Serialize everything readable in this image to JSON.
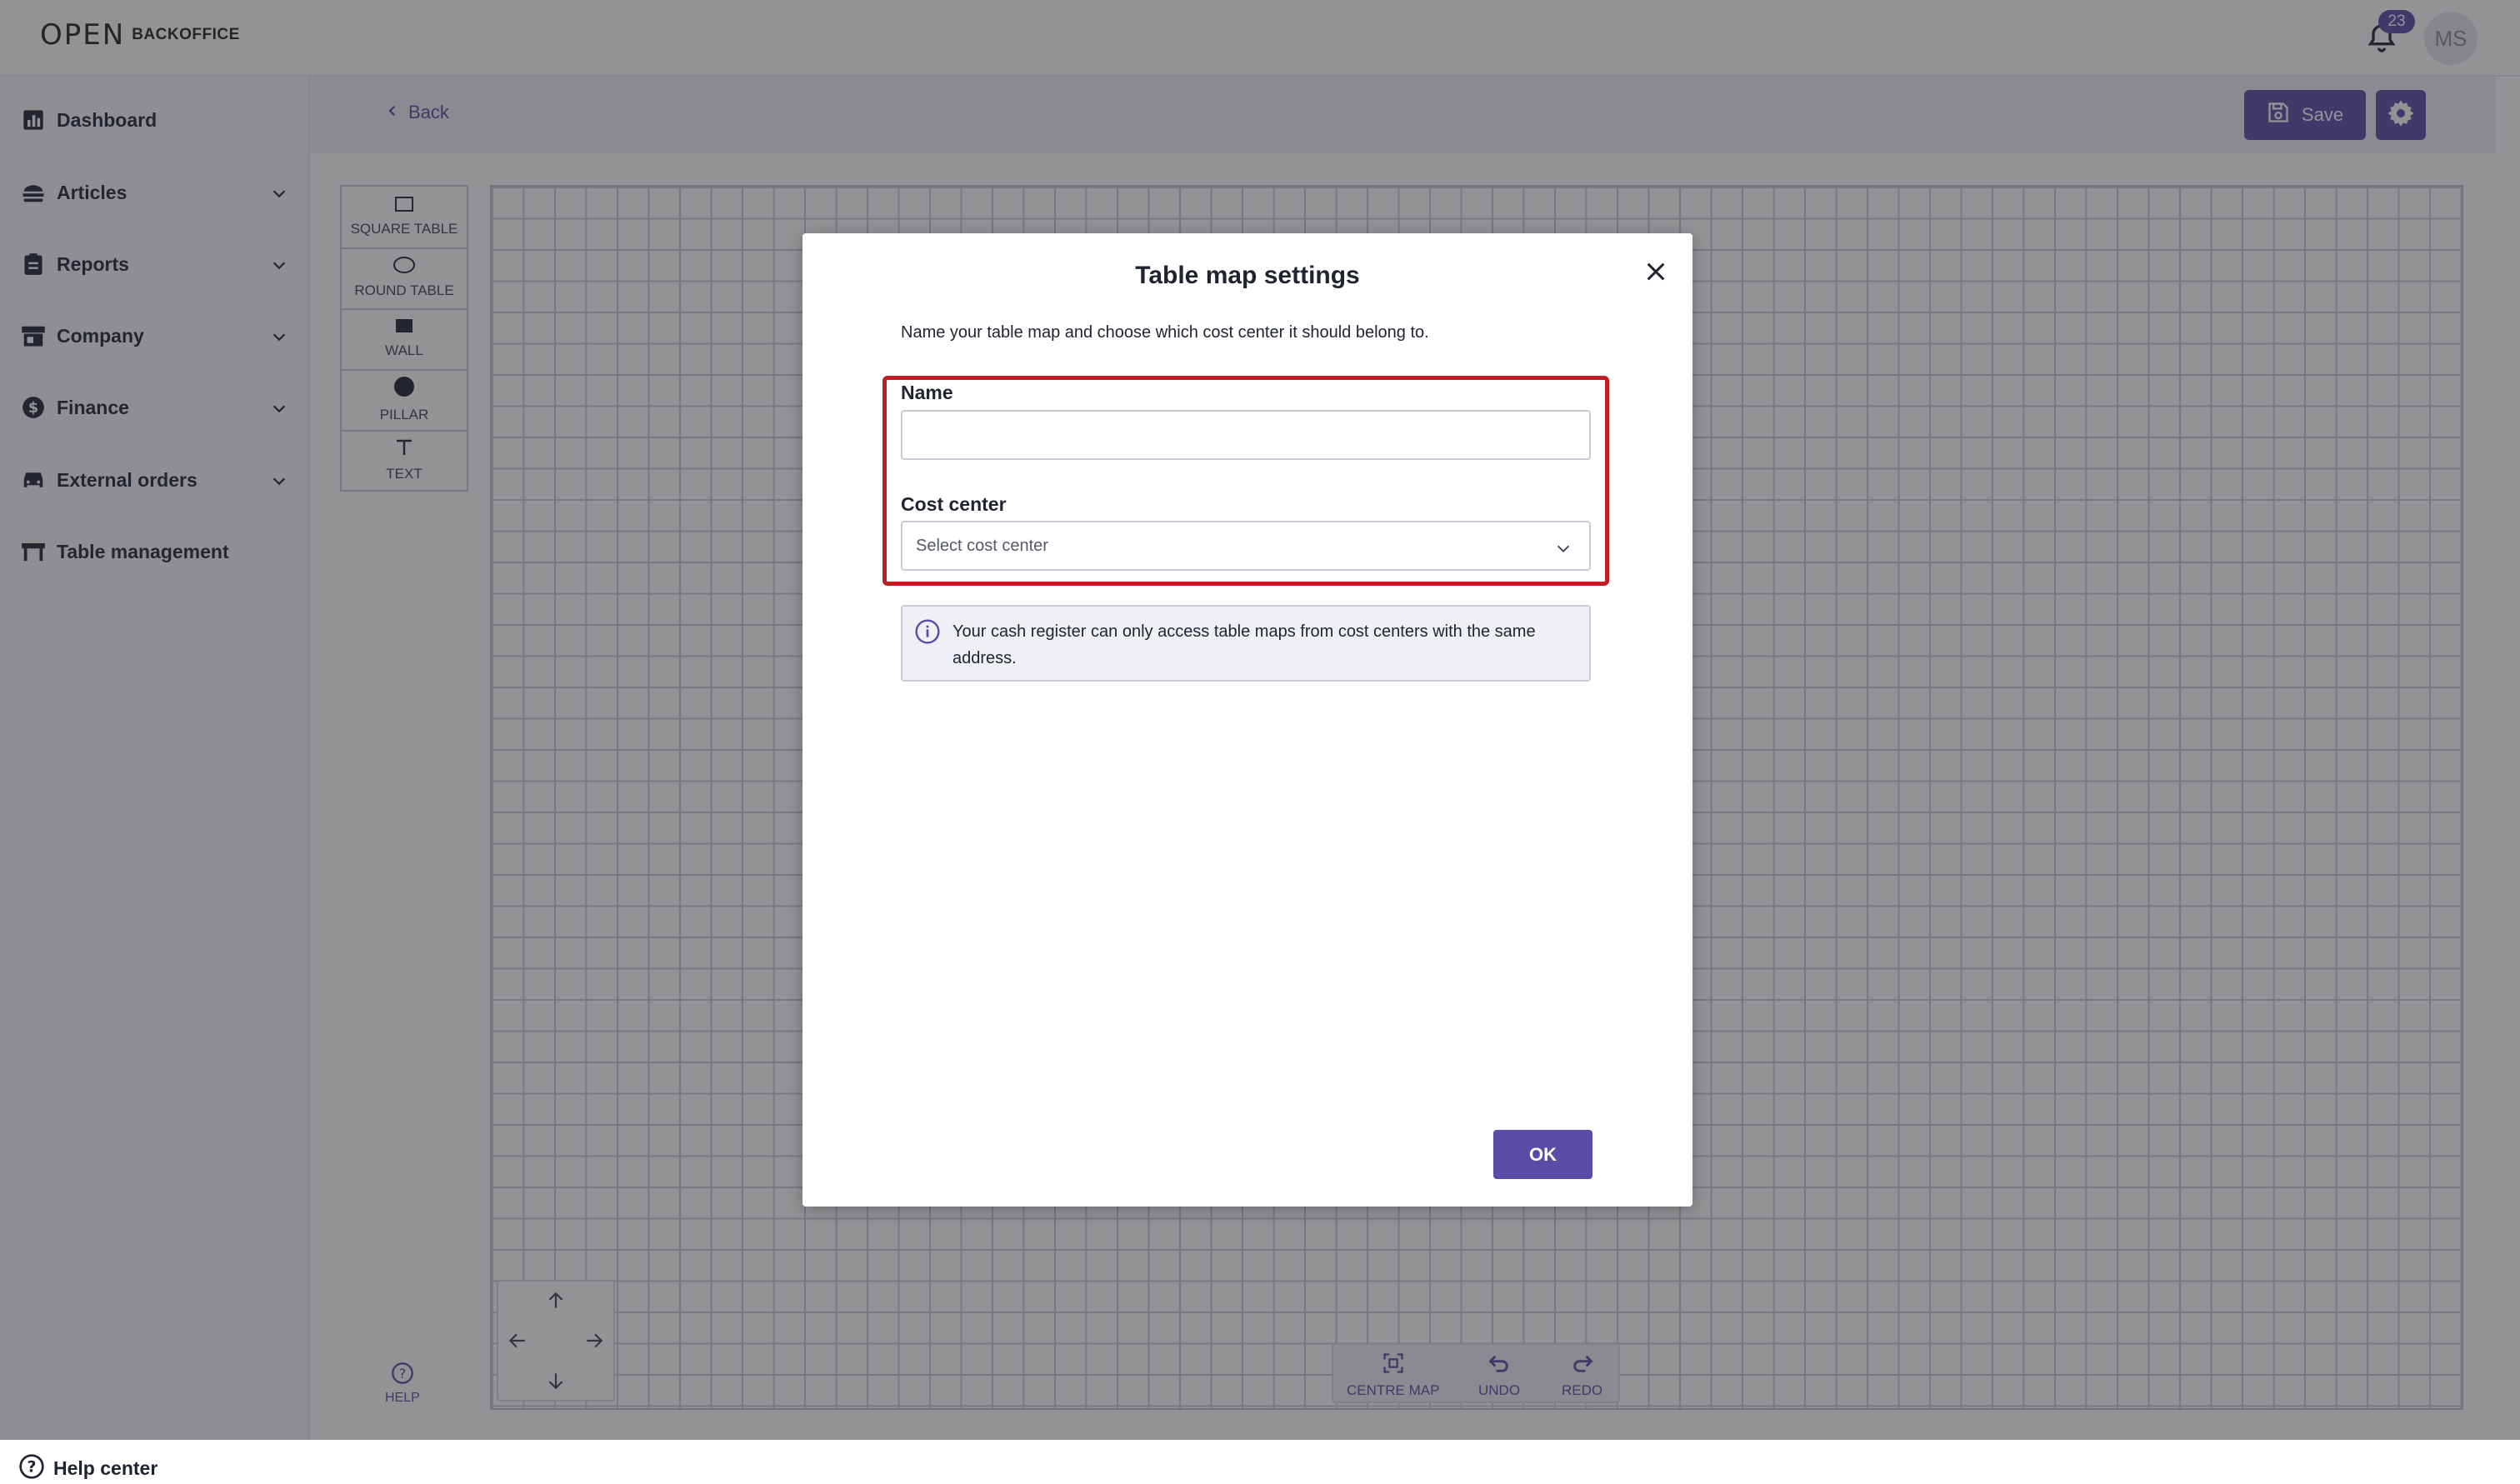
{
  "app": {
    "logo_mark": "OPEN",
    "logo_text": "BACKOFFICE"
  },
  "topbar": {
    "notification_count": "23",
    "avatar_initials": "MS"
  },
  "sidebar": {
    "items": [
      {
        "label": "Dashboard",
        "icon": "bar-chart-icon",
        "expandable": false
      },
      {
        "label": "Articles",
        "icon": "burger-icon",
        "expandable": true
      },
      {
        "label": "Reports",
        "icon": "clipboard-icon",
        "expandable": true
      },
      {
        "label": "Company",
        "icon": "store-icon",
        "expandable": true
      },
      {
        "label": "Finance",
        "icon": "dollar-icon",
        "expandable": true
      },
      {
        "label": "External orders",
        "icon": "car-icon",
        "expandable": true
      },
      {
        "label": "Table management",
        "icon": "table-icon",
        "expandable": false
      }
    ],
    "help_center": "Help center"
  },
  "header": {
    "back_label": "Back",
    "save_label": "Save"
  },
  "palette": {
    "tools": [
      {
        "label": "SQUARE TABLE",
        "icon": "square-icon"
      },
      {
        "label": "ROUND TABLE",
        "icon": "ellipse-icon"
      },
      {
        "label": "WALL",
        "icon": "wall-icon"
      },
      {
        "label": "PILLAR",
        "icon": "circle-icon"
      },
      {
        "label": "TEXT",
        "icon": "text-icon"
      }
    ]
  },
  "canvas_controls": {
    "help_label": "HELP",
    "centre_map": "CENTRE MAP",
    "undo": "UNDO",
    "redo": "REDO"
  },
  "modal": {
    "title": "Table map settings",
    "description": "Name your table map and choose which cost center it should belong to.",
    "name_label": "Name",
    "name_value": "",
    "cost_center_label": "Cost center",
    "cost_center_placeholder": "Select cost center",
    "info_text": "Your cash register can only access table maps from cost centers with the same address.",
    "ok_label": "OK"
  },
  "colors": {
    "accent": "#5b4ba6",
    "highlight": "#c11c24",
    "overlay": "rgba(40,40,46,0.5)"
  }
}
